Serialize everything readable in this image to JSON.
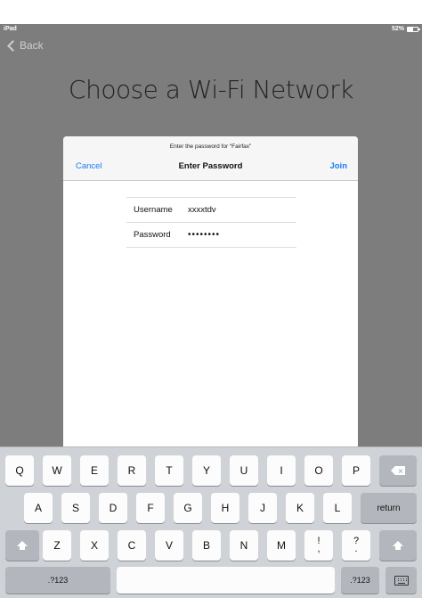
{
  "status_bar": {
    "device": "iPad",
    "battery": "52%",
    "battery_level": 0.52
  },
  "nav": {
    "back_label": "Back"
  },
  "background_title": "Choose a Wi-Fi Network",
  "dialog": {
    "prompt": "Enter the password for “Fairfax”",
    "title": "Enter Password",
    "cancel_label": "Cancel",
    "join_label": "Join",
    "fields": [
      {
        "label": "Username",
        "value": "xxxxtdv"
      },
      {
        "label": "Password",
        "value": "••••••••"
      }
    ]
  },
  "keyboard": {
    "row1": [
      "Q",
      "W",
      "E",
      "R",
      "T",
      "Y",
      "U",
      "I",
      "O",
      "P"
    ],
    "row2": [
      "A",
      "S",
      "D",
      "F",
      "G",
      "H",
      "J",
      "K",
      "L"
    ],
    "row3": [
      "Z",
      "X",
      "C",
      "V",
      "B",
      "N",
      "M"
    ],
    "return_label": "return",
    "numbers_label": ".?123",
    "punct1": {
      "top": "!",
      "bottom": ","
    },
    "punct2": {
      "top": "?",
      "bottom": "."
    },
    "icons": {
      "delete": "delete-icon",
      "shift": "shift-icon",
      "dismiss": "keyboard-dismiss-icon"
    }
  }
}
